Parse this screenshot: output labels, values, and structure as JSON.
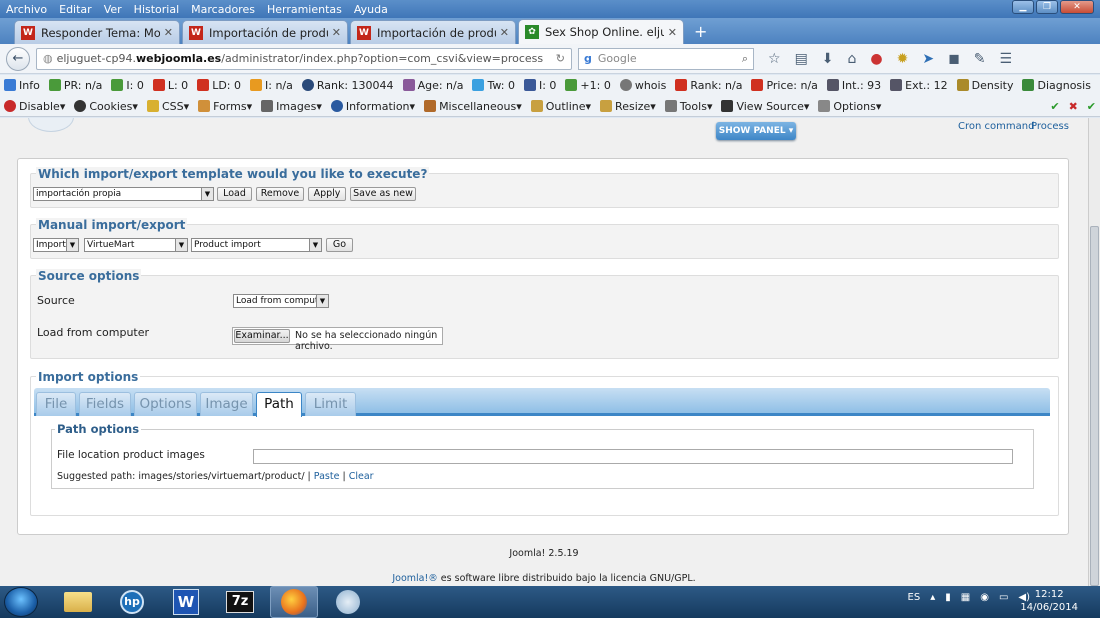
{
  "menu": [
    "Archivo",
    "Editar",
    "Ver",
    "Historial",
    "Marcadores",
    "Herramientas",
    "Ayuda"
  ],
  "tabs": [
    {
      "label": "Responder Tema: Modifica...",
      "active": false
    },
    {
      "label": "Importación de productos ...",
      "active": false
    },
    {
      "label": "Importación de productos ...",
      "active": false
    },
    {
      "label": "Sex Shop Online. eljuguete...",
      "active": true
    }
  ],
  "address": {
    "prefix": "eljuguet-cp94.",
    "domain": "webjoomla.es",
    "path": "/administrator/index.php?option=com_csvi&view=process"
  },
  "search": {
    "placeholder": "Google"
  },
  "seo_toolbar": [
    "Info",
    "PR: n/a",
    "I: 0",
    "L: 0",
    "LD: 0",
    "I: n/a",
    "Rank: 130044",
    "Age: n/a",
    "Tw: 0",
    "I: 0",
    "+1: 0",
    "whois",
    "Rank: n/a",
    "Price: n/a",
    "Int.: 93",
    "Ext.: 12",
    "Density",
    "Diagnosis"
  ],
  "dev_toolbar": [
    "Disable",
    "Cookies",
    "CSS",
    "Forms",
    "Images",
    "Information",
    "Miscellaneous",
    "Outline",
    "Resize",
    "Tools",
    "View Source",
    "Options"
  ],
  "header": {
    "show_panel": "SHOW PANEL",
    "cron": "Cron command",
    "process": "Process"
  },
  "template_section": {
    "title": "Which import/export template would you like to execute?",
    "selected": "importación propia",
    "buttons": {
      "load": "Load",
      "remove": "Remove",
      "apply": "Apply",
      "save_new": "Save as new"
    }
  },
  "manual_section": {
    "title": "Manual import/export",
    "action": "Import",
    "component": "VirtueMart",
    "operation": "Product import",
    "go": "Go"
  },
  "source_section": {
    "title": "Source options",
    "source_label": "Source",
    "source_value": "Load from computer",
    "file_label": "Load from computer",
    "browse": "Examinar...",
    "no_file": "No se ha seleccionado ningún archivo."
  },
  "import_section": {
    "title": "Import options",
    "tabs": [
      "File",
      "Fields",
      "Options",
      "Image",
      "Path",
      "Limit"
    ],
    "active_tab": "Path",
    "path_options": "Path options",
    "file_location_label": "File location product images",
    "suggested_prefix": "Suggested path: images/stories/virtuemart/product/",
    "sep1": "|",
    "paste": "Paste",
    "sep2": "|",
    "clear": "Clear"
  },
  "footer": {
    "version": "Joomla! 2.5.19",
    "link": "Joomla!®",
    "license": " es software libre distribuido bajo la licencia GNU/GPL."
  },
  "taskbar": {
    "lang": "ES",
    "time": "12:12",
    "date": "14/06/2014"
  }
}
